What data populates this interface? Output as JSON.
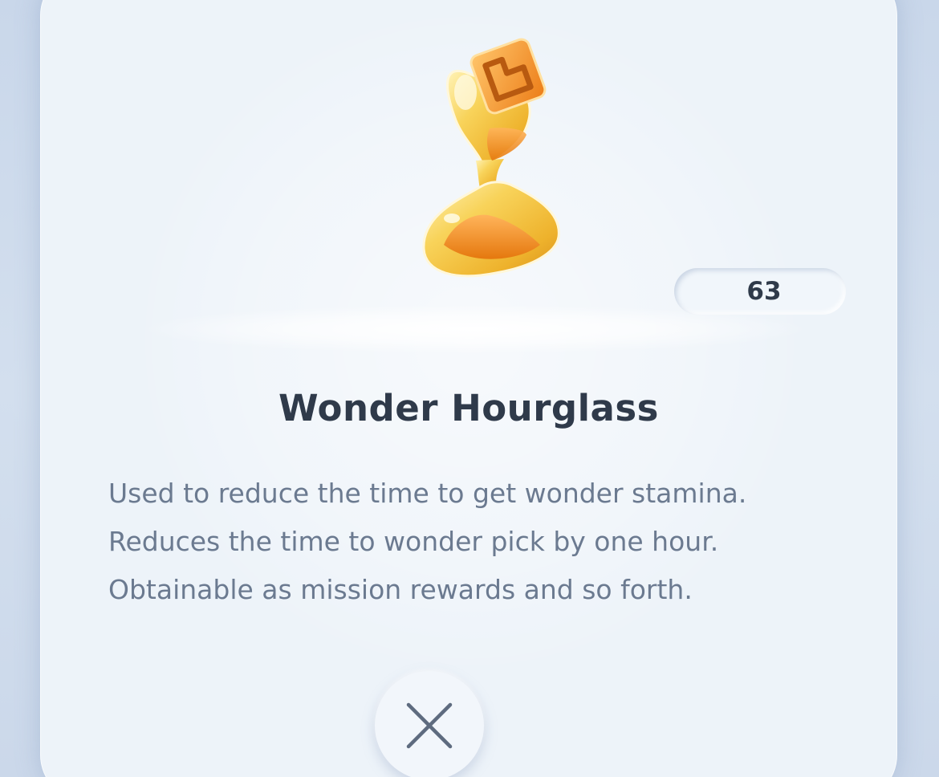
{
  "item": {
    "name": "Wonder Hourglass",
    "count": "63",
    "description": [
      "Used to reduce the time to get wonder stamina.",
      "Reduces the time to wonder pick by one hour.",
      "Obtainable as mission rewards and so forth."
    ],
    "icon": "wonder-hourglass-icon"
  },
  "close_button": {
    "icon": "close-icon"
  },
  "colors": {
    "background": "#cfdbeb",
    "card": "#edf3f9",
    "title_text": "#2f3a4a",
    "body_text": "#6b7a90",
    "hourglass_gold": "#f5c23a",
    "hourglass_sand": "#ee8c1c"
  }
}
